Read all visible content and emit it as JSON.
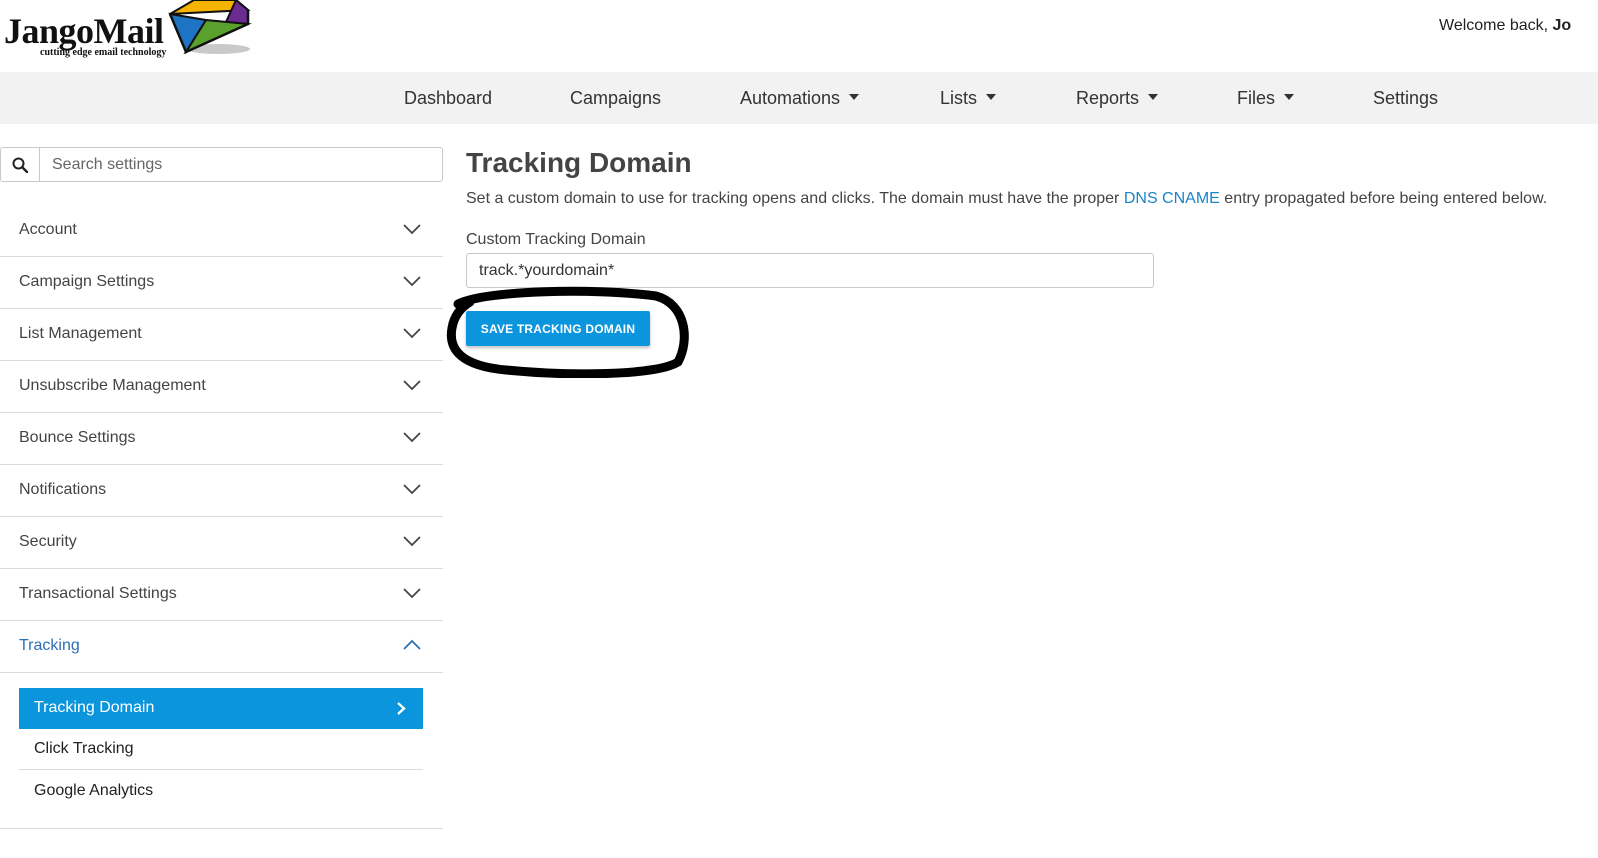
{
  "header": {
    "logo_text": "JangoMail",
    "logo_tagline": "cutting edge email technology",
    "welcome_prefix": "Welcome back, ",
    "welcome_user": "Jo"
  },
  "nav": {
    "items": [
      {
        "label": "Dashboard",
        "dropdown": false
      },
      {
        "label": "Campaigns",
        "dropdown": false
      },
      {
        "label": "Automations",
        "dropdown": true
      },
      {
        "label": "Lists",
        "dropdown": true
      },
      {
        "label": "Reports",
        "dropdown": true
      },
      {
        "label": "Files",
        "dropdown": true
      },
      {
        "label": "Settings",
        "dropdown": false
      }
    ]
  },
  "sidebar": {
    "search_placeholder": "Search settings",
    "items": [
      {
        "label": "Account",
        "expanded": false
      },
      {
        "label": "Campaign Settings",
        "expanded": false
      },
      {
        "label": "List Management",
        "expanded": false
      },
      {
        "label": "Unsubscribe Management",
        "expanded": false
      },
      {
        "label": "Bounce Settings",
        "expanded": false
      },
      {
        "label": "Notifications",
        "expanded": false
      },
      {
        "label": "Security",
        "expanded": false
      },
      {
        "label": "Transactional Settings",
        "expanded": false
      },
      {
        "label": "Tracking",
        "expanded": true
      }
    ],
    "sub_items": [
      {
        "label": "Tracking Domain",
        "selected": true
      },
      {
        "label": "Click Tracking",
        "selected": false
      },
      {
        "label": "Google Analytics",
        "selected": false
      }
    ]
  },
  "main": {
    "title": "Tracking Domain",
    "description_before": "Set a custom domain to use for tracking opens and clicks. The domain must have the proper ",
    "description_link": "DNS CNAME",
    "description_after": " entry propagated before being entered below.",
    "field_label": "Custom Tracking Domain",
    "field_value": "track.*yourdomain*",
    "save_label": "SAVE TRACKING DOMAIN"
  },
  "colors": {
    "accent": "#0b95dc",
    "link": "#1a85c8",
    "navbar_bg": "#f2f2f2",
    "active_sidebar_text": "#2f6fb3",
    "logo_yellow": "#f5b400",
    "logo_purple": "#6b2c91",
    "logo_green": "#5aa02c",
    "logo_blue": "#1d73c4"
  },
  "icons": {
    "search": "search-icon",
    "collapsed": "chevron-down-icon",
    "expanded": "chevron-up-icon",
    "selected_sub": "chevron-right-icon"
  }
}
